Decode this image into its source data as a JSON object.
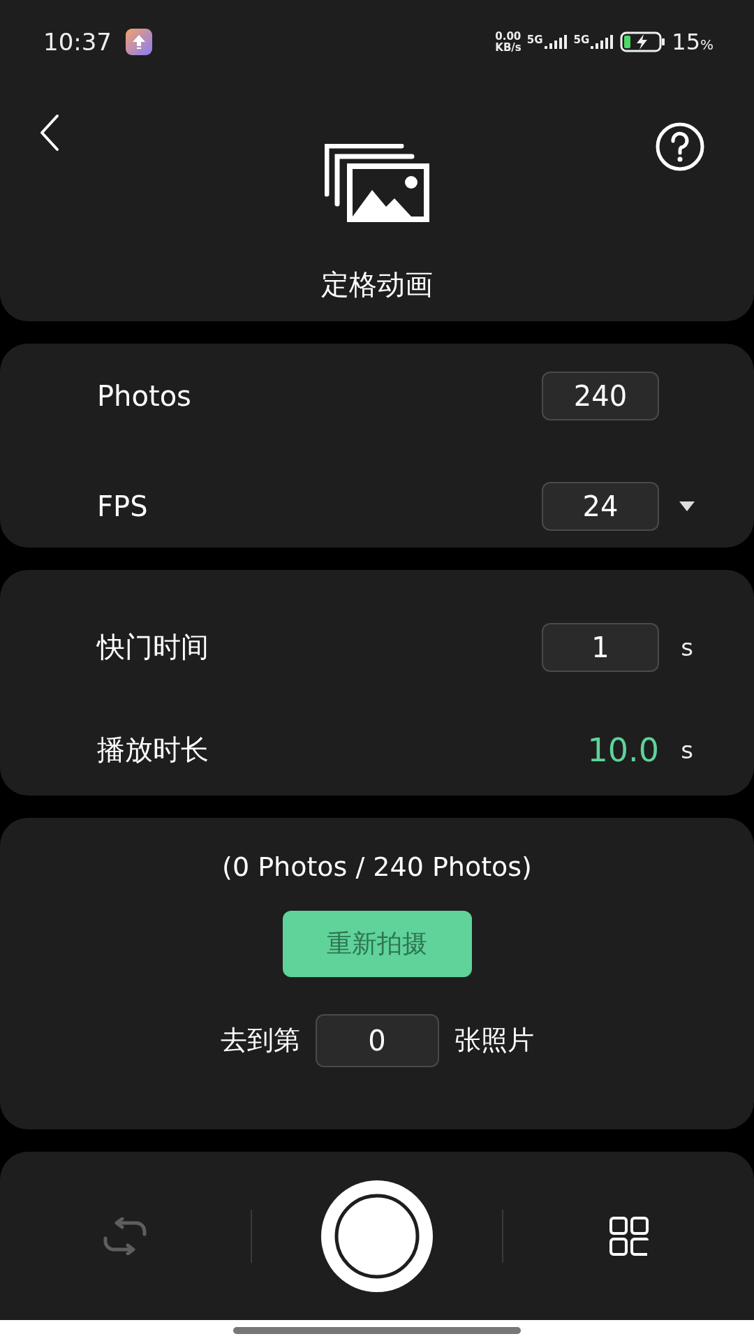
{
  "status_bar": {
    "time": "10:37",
    "net_speed_value": "0.00",
    "net_speed_unit": "KB/s",
    "sim_1": "5G",
    "sim_2": "5G",
    "battery": "15",
    "battery_unit": "%"
  },
  "header": {
    "title": "定格动画"
  },
  "setting_cards": [
    {
      "rows": [
        {
          "label": "Photos",
          "value": "240",
          "kind": "input"
        },
        {
          "label": "FPS",
          "value": "24",
          "kind": "dropdown"
        }
      ]
    },
    {
      "rows": [
        {
          "label": "快门时间",
          "value": "1",
          "unit": "s",
          "kind": "input"
        },
        {
          "label": "播放时长",
          "value": "10.0",
          "unit": "s",
          "kind": "readout"
        }
      ]
    }
  ],
  "capture_card": {
    "progress": "(0 Photos / 240 Photos)",
    "retake_button": "重新拍摄",
    "goto_prefix": "去到第",
    "goto_value": "0",
    "goto_suffix": "张照片"
  },
  "toolbar": [
    {
      "kind": "repeat",
      "disabled": true
    },
    {
      "kind": "shutter",
      "disabled": false
    },
    {
      "kind": "grid",
      "disabled": false
    }
  ]
}
